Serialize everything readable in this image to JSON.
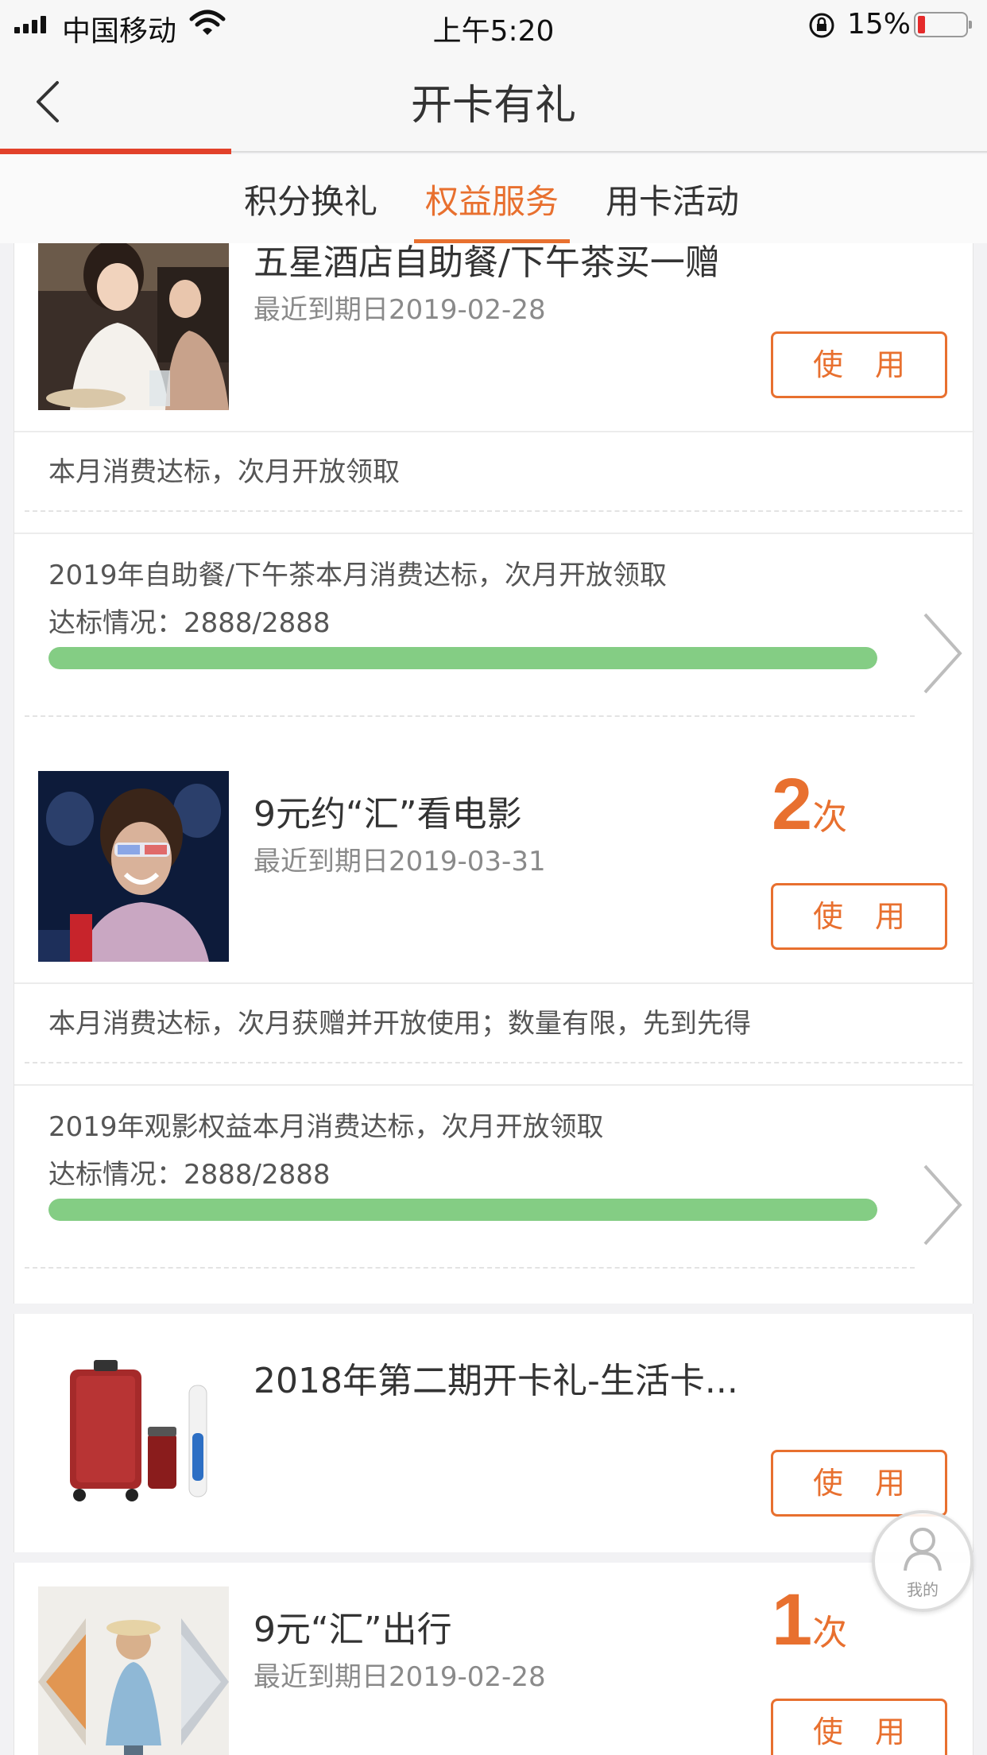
{
  "status_bar": {
    "carrier": "中国移动",
    "time": "上午5:20",
    "battery": "15%"
  },
  "header": {
    "title": "开卡有礼"
  },
  "tabs": [
    {
      "label": "积分换礼"
    },
    {
      "label": "权益服务"
    },
    {
      "label": "用卡活动"
    }
  ],
  "cards": [
    {
      "title": "五星酒店自助餐/下午茶买一赠",
      "date": "最近到期日2019-02-28",
      "button": "使用",
      "note": "本月消费达标，次月开放领取",
      "progress_title": "2019年自助餐/下午茶本月消费达标，次月开放领取",
      "progress_label": "达标情况：2888/2888",
      "progress": 1.0
    },
    {
      "title": "9元约“汇”看电影",
      "date": "最近到期日2019-03-31",
      "count": "2",
      "count_unit": "次",
      "button": "使用",
      "note": "本月消费达标，次月获赠并开放使用；数量有限，先到先得",
      "progress_title": "2019年观影权益本月消费达标，次月开放领取",
      "progress_label": "达标情况：2888/2888",
      "progress": 1.0
    },
    {
      "title": "2018年第二期开卡礼-生活卡...",
      "button": "使用"
    },
    {
      "title": "9元“汇”出行",
      "date": "最近到期日2019-02-28",
      "count": "1",
      "count_unit": "次",
      "button": "使用"
    }
  ],
  "fab": {
    "label": "我的"
  },
  "colors": {
    "accent": "#e8702f",
    "progress": "#84cd84",
    "nav_red": "#e2412a"
  }
}
